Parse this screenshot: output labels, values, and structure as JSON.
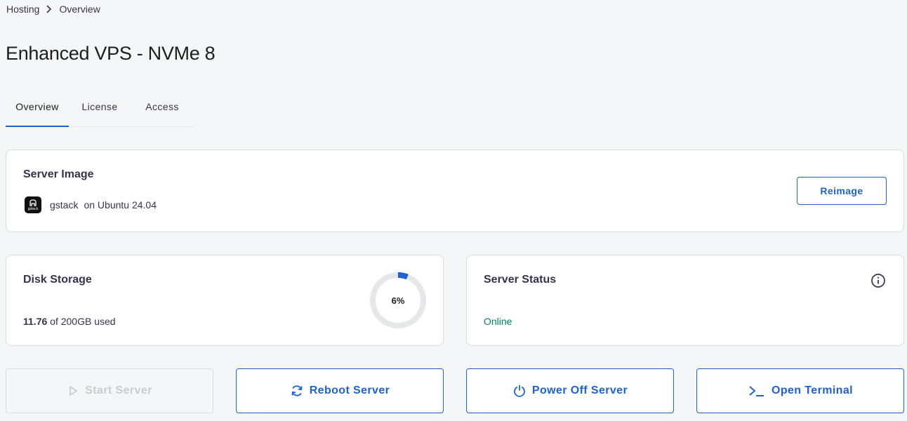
{
  "breadcrumb": {
    "items": [
      "Hosting",
      "Overview"
    ]
  },
  "page": {
    "title": "Enhanced VPS - NVMe 8"
  },
  "tabs": [
    {
      "label": "Overview",
      "active": true
    },
    {
      "label": "License",
      "active": false
    },
    {
      "label": "Access",
      "active": false
    }
  ],
  "server_image": {
    "title": "Server Image",
    "logo_text": "gstack",
    "image_name": "gstack",
    "os_text": "on Ubuntu 24.04",
    "reimage_label": "Reimage"
  },
  "disk_storage": {
    "title": "Disk Storage",
    "used": "11.76",
    "total_text": "of 200GB used",
    "percent_label": "6%",
    "percent_value": 6
  },
  "server_status": {
    "title": "Server Status",
    "status": "Online",
    "info_icon": "info-icon"
  },
  "actions": {
    "start": {
      "label": "Start Server",
      "icon": "play-icon",
      "disabled": true
    },
    "reboot": {
      "label": "Reboot Server",
      "icon": "refresh-icon"
    },
    "poweroff": {
      "label": "Power Off Server",
      "icon": "power-icon"
    },
    "terminal": {
      "label": "Open Terminal",
      "icon": "terminal-icon"
    }
  },
  "colors": {
    "primary": "#1d61d4",
    "online": "#00855a",
    "disabled": "#c8ccd2",
    "donut_track": "#e6e7ea"
  }
}
